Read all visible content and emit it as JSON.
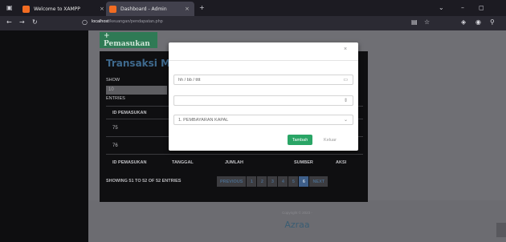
{
  "browser": {
    "tabs": [
      {
        "title": "Welcome to XAMPP"
      },
      {
        "title": "Dashboard - Admin"
      }
    ],
    "new_tab": "+",
    "close_glyph": "×",
    "url_host": "localhost",
    "url_path": "/keuangan/pendapatan.php"
  },
  "page": {
    "add_button": "+ Pemasukan",
    "card_title": "Transaksi Ma",
    "show_label": "SHOW",
    "show_value": "10",
    "entries_label": "ENTRIES",
    "table": {
      "headers": [
        "ID PEMASUKAN",
        "TANGGAL",
        "JUMLAH",
        "SUMBER",
        "AKSI"
      ],
      "rows": [
        {
          "id": "75"
        },
        {
          "id": "76"
        }
      ]
    },
    "info": "SHOWING 51 TO 52 OF 52 ENTRIES",
    "pagination": {
      "previous": "PREVIOUS",
      "pages": [
        "1",
        "2",
        "3",
        "4",
        "5",
        "6"
      ],
      "active": "6",
      "next": "NEXT"
    },
    "footer": {
      "copyright": "Copyright © 2023 -",
      "brand": "Azraa"
    }
  },
  "modal": {
    "close_glyph": "×",
    "date_placeholder": "hh / bb / tttt",
    "number_value": "",
    "select_value": "1. PEMBAYARAN KAPAL",
    "submit_label": "Tambah",
    "cancel_label": "Keluar"
  },
  "colors": {
    "accent_green": "#2aa566",
    "title_blue": "#3f6a8e",
    "active_page": "#3e5f8a"
  }
}
